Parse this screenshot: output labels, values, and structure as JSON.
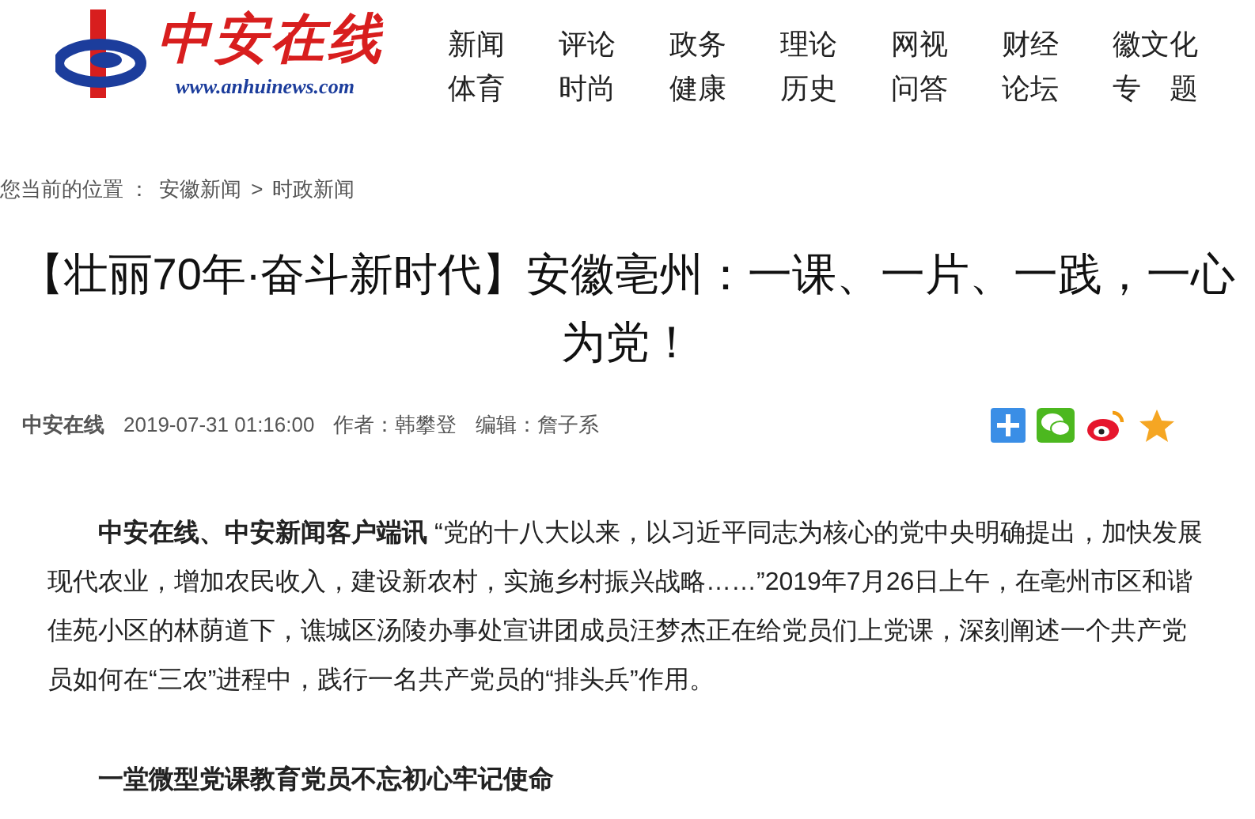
{
  "logo": {
    "name": "中安在线",
    "url": "www.anhuinews.com"
  },
  "nav": [
    [
      "新闻",
      "评论",
      "政务",
      "理论",
      "网视",
      "财经",
      "徽文化"
    ],
    [
      "体育",
      "时尚",
      "健康",
      "历史",
      "问答",
      "论坛",
      "专　题"
    ]
  ],
  "breadcrumb": {
    "label": "您当前的位置 ：",
    "items": [
      "安徽新闻",
      "时政新闻"
    ],
    "separator": ">"
  },
  "article": {
    "title": "【壮丽70年·奋斗新时代】安徽亳州：一课、一片、一践，一心为党！",
    "source": "中安在线",
    "date": "2019-07-31 01:16:00",
    "author": "作者：韩攀登",
    "editor": "编辑：詹子系",
    "share": [
      {
        "kind": "plus"
      },
      {
        "kind": "wechat"
      },
      {
        "kind": "weibo"
      },
      {
        "kind": "qzone"
      }
    ],
    "paragraphs": [
      {
        "kind": "text",
        "text": "**中安在线、中安新闻客户端讯** “党的十八大以来，以习近平同志为核心的党中央明确提出，加快发展现代农业，增加农民收入，建设新农村，实施乡村振兴战略……”2019年7月26日上午，在亳州市区和谐佳苑小区的林荫道下，谯城区汤陵办事处宣讲团成员汪梦杰正在给党员们上党课，深刻阐述一个共产党员如何在“三农”进程中，践行一名共产党员的“排头兵”作用。"
      },
      {
        "kind": "heading",
        "text": "一堂微型党课教育党员不忘初心牢记使命"
      }
    ]
  }
}
